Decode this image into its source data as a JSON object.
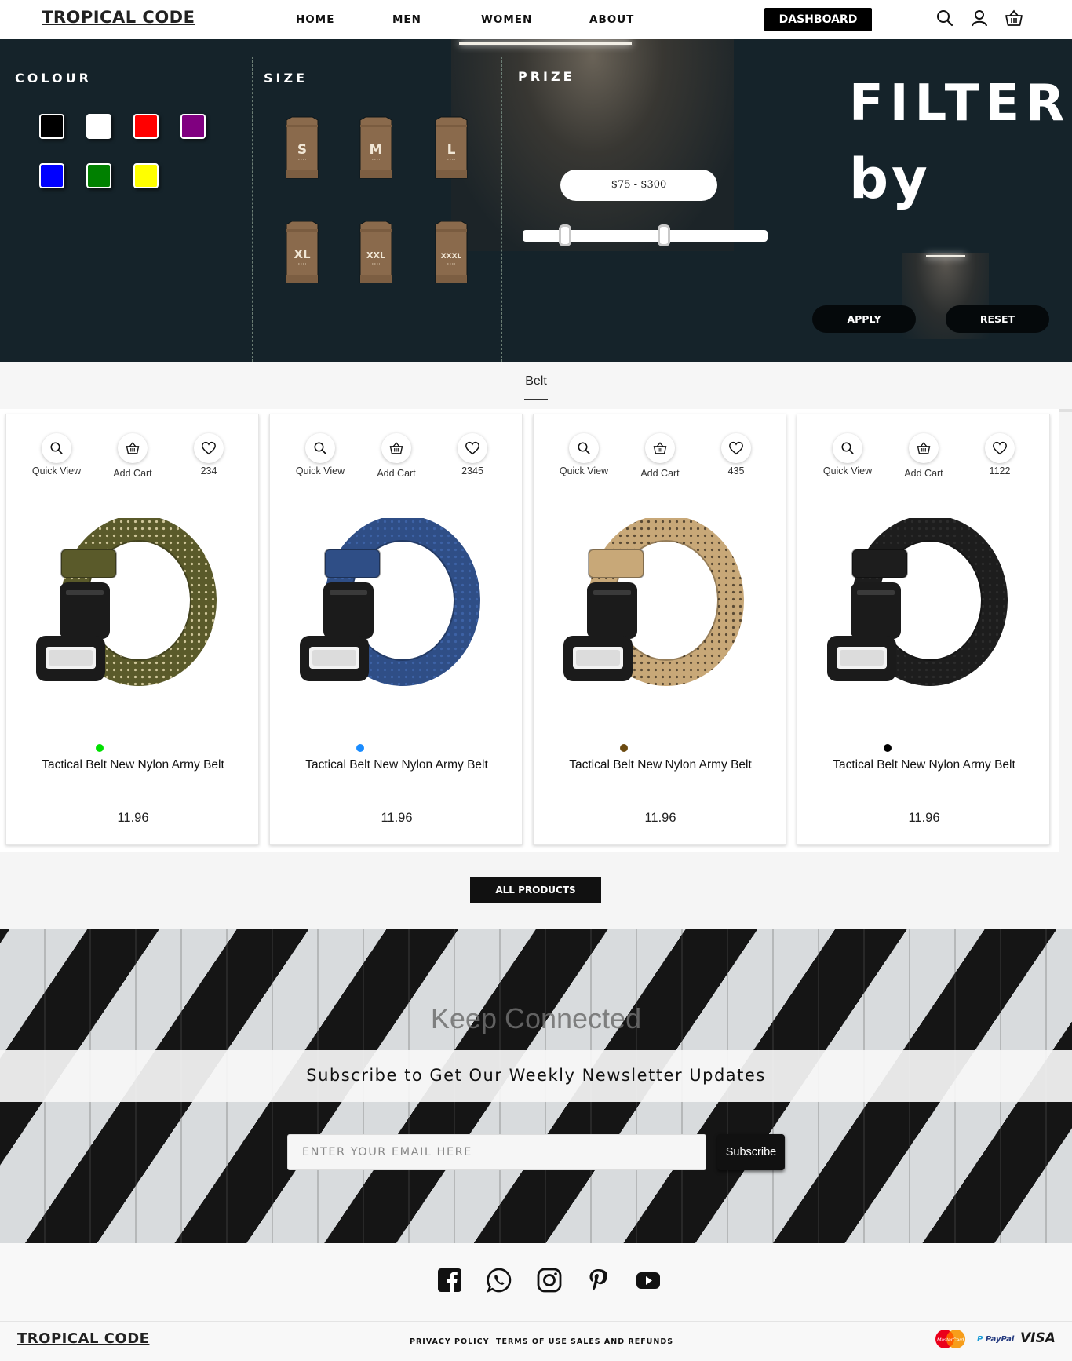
{
  "brand": "TROPICAL CODE",
  "nav": {
    "home": "HOME",
    "men": "MEN",
    "women": "WOMEN",
    "about": "ABOUT",
    "dashboard": "DASHBOARD"
  },
  "filter": {
    "colour_label": "COLOUR",
    "size_label": "SIZE",
    "prize_label": "PRIZE",
    "colours": [
      "#000000",
      "#ffffff",
      "#ff0000",
      "#800080",
      "#0000ff",
      "#008000",
      "#ffff00"
    ],
    "sizes": [
      "S",
      "M",
      "L",
      "XL",
      "XXL",
      "XXXL"
    ],
    "price_range": "$75 - $300",
    "title_line1": "FILTER",
    "title_line2": "by",
    "apply": "APPLY",
    "reset": "RESET"
  },
  "category": "Belt",
  "products": [
    {
      "name": "Tactical Belt New Nylon Army Belt",
      "price": "11.96",
      "likes": "234",
      "dot_color": "#00e000",
      "belt_color": "#5a5a2a",
      "pattern": "#cfc69a"
    },
    {
      "name": "Tactical Belt New Nylon Army Belt",
      "price": "11.96",
      "likes": "2345",
      "dot_color": "#1a8cff",
      "belt_color": "#2f4e86",
      "pattern": "#3d62a6"
    },
    {
      "name": "Tactical Belt New Nylon Army Belt",
      "price": "11.96",
      "likes": "435",
      "dot_color": "#6b4a10",
      "belt_color": "#c8a878",
      "pattern": "#5a4a34"
    },
    {
      "name": "Tactical Belt New Nylon Army Belt",
      "price": "11.96",
      "likes": "1122",
      "dot_color": "#000000",
      "belt_color": "#1d1d1d",
      "pattern": "#2c2c2c"
    }
  ],
  "actions": {
    "quick_view": "Quick View",
    "add_cart": "Add Cart"
  },
  "all_products": "ALL PRODUCTS",
  "newsletter": {
    "heading": "Keep Connected",
    "subtitle": "Subscribe to Get Our Weekly Newsletter Updates",
    "placeholder": "ENTER YOUR EMAIL HERE",
    "button": "Subscribe"
  },
  "footer": {
    "links": [
      "PRIVACY POLICY",
      "TERMS OF USE",
      "SALES AND REFUNDS"
    ],
    "payments": {
      "mastercard": "MasterCard",
      "paypal": "PayPal",
      "visa": "VISA"
    }
  }
}
